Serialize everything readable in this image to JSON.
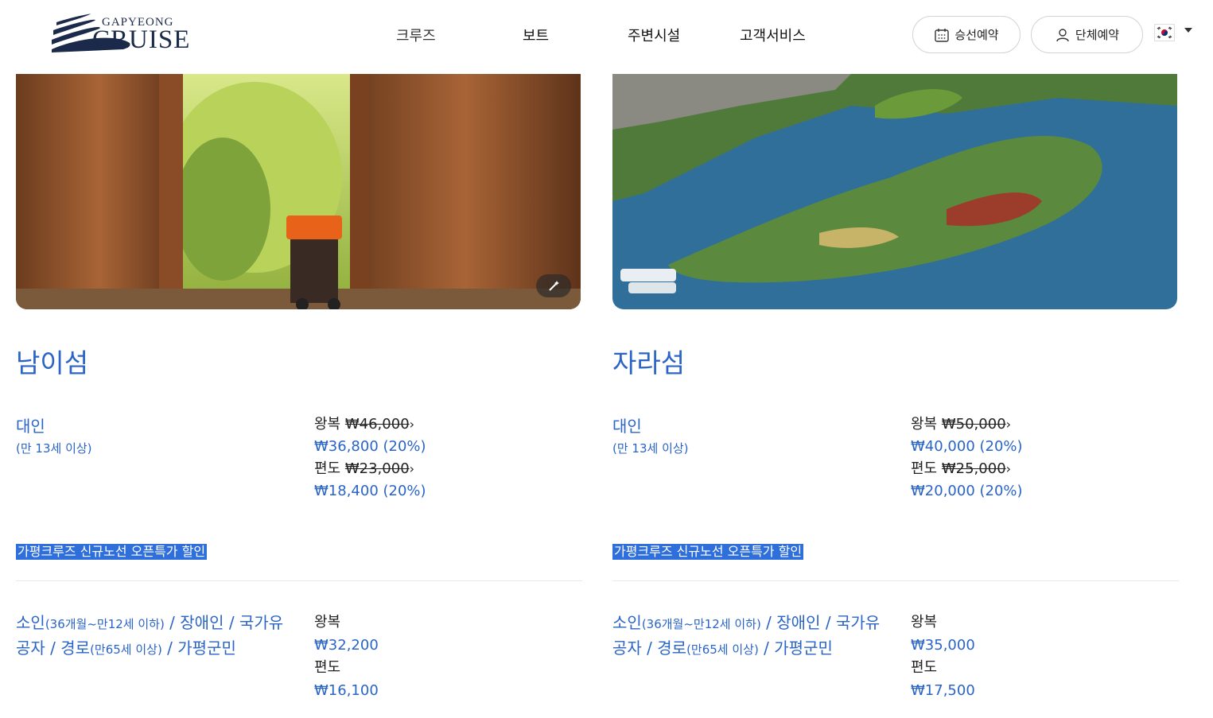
{
  "header": {
    "logo_sub": "GAPYEONG",
    "logo_main": "CRUISE",
    "nav": [
      "크루즈",
      "보트",
      "주변시설",
      "고객서비스"
    ],
    "booking_button": "승선예약",
    "group_button": "단체예약",
    "language_icon": "korea-flag-icon"
  },
  "cards": [
    {
      "title": "남이섬",
      "adult_label": "대인",
      "adult_sub": "(만 13세 이상)",
      "round_label": "왕복",
      "round_original": "₩46,000",
      "round_sale": "₩36,800 (20%)",
      "oneway_label": "편도",
      "oneway_original": "₩23,000",
      "oneway_sale": "₩18,400 (20%)",
      "promo": "가평크루즈 신규노선 오픈특가 할인",
      "disc_a": "소인",
      "disc_a_sub": "(36개월~만12세 이하)",
      "disc_b": " / 장애인 / 국가유공자 / 경로",
      "disc_b_sub": "(만65세 이상)",
      "disc_c": " / 가평군민",
      "disc_round_label": "왕복",
      "disc_round": "₩32,200",
      "disc_oneway_label": "편도",
      "disc_oneway": "₩16,100"
    },
    {
      "title": "자라섬",
      "adult_label": "대인",
      "adult_sub": "(만 13세 이상)",
      "round_label": "왕복",
      "round_original": "₩50,000",
      "round_sale": "₩40,000 (20%)",
      "oneway_label": "편도",
      "oneway_original": "₩25,000",
      "oneway_sale": "₩20,000 (20%)",
      "promo": "가평크루즈 신규노선 오픈특가 할인",
      "disc_a": "소인",
      "disc_a_sub": "(36개월~만12세 이하)",
      "disc_b": " / 장애인 / 국가유공자 / 경로",
      "disc_b_sub": "(만65세 이상)",
      "disc_c": " / 가평군민",
      "disc_round_label": "왕복",
      "disc_round": "₩35,000",
      "disc_oneway_label": "편도",
      "disc_oneway": "₩17,500"
    }
  ],
  "colors": {
    "accent": "#2a64c7",
    "promo_bg": "#2f6fdc",
    "logo": "#1b2a4a"
  }
}
